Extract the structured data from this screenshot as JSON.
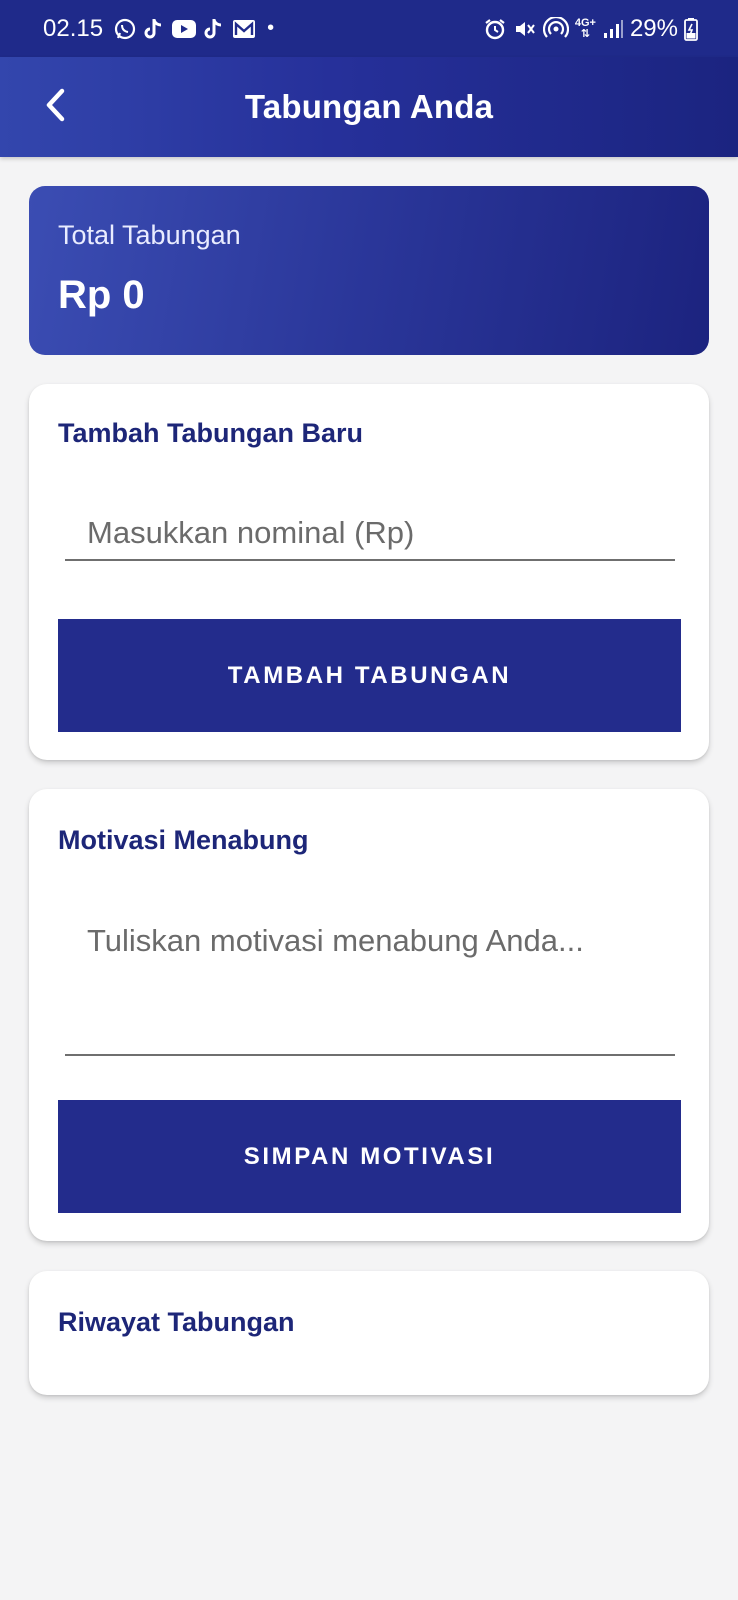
{
  "status_bar": {
    "time": "02.15",
    "battery": "29%",
    "network": "4G+",
    "left_icons": [
      "whatsapp-icon",
      "tiktok-icon",
      "youtube-icon",
      "tiktok-icon",
      "mail-icon"
    ],
    "right_icons": [
      "alarm-icon",
      "mute-icon",
      "hotspot-icon",
      "signal-icon",
      "battery-charging-icon"
    ]
  },
  "app_bar": {
    "title": "Tabungan Anda",
    "back_icon": "chevron-left-icon"
  },
  "total": {
    "label": "Total Tabungan",
    "value": "Rp 0"
  },
  "add_savings": {
    "title": "Tambah Tabungan Baru",
    "input_placeholder": "Masukkan nominal (Rp)",
    "input_value": "",
    "button_label": "TAMBAH TABUNGAN"
  },
  "motivation": {
    "title": "Motivasi Menabung",
    "input_placeholder": "Tuliskan motivasi menabung Anda...",
    "input_value": "",
    "button_label": "SIMPAN MOTIVASI"
  },
  "history": {
    "title": "Riwayat Tabungan"
  },
  "colors": {
    "primary": "#232c8c",
    "title_text": "#1d2678",
    "background": "#f4f4f5"
  }
}
